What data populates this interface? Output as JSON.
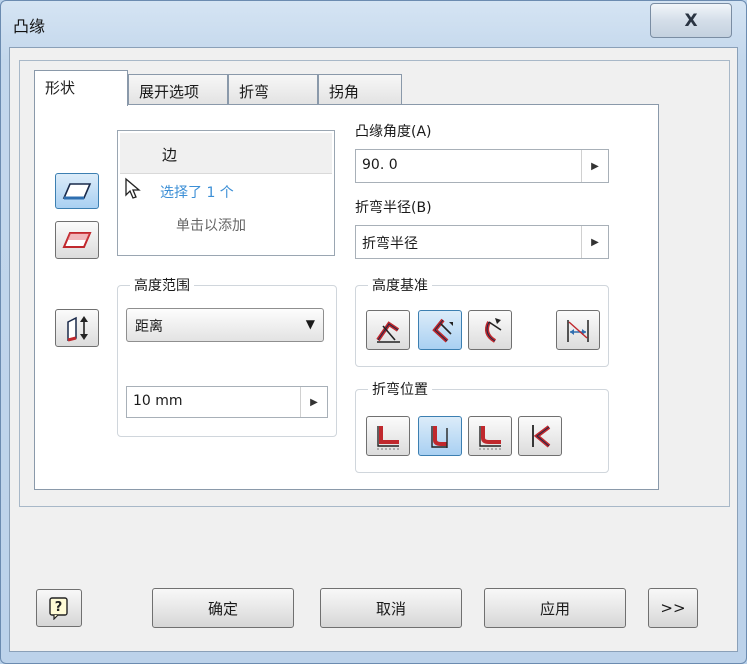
{
  "window": {
    "title": "凸缘",
    "close_label": "X"
  },
  "tabs": [
    {
      "label": "形状",
      "active": true
    },
    {
      "label": "展开选项",
      "active": false
    },
    {
      "label": "折弯",
      "active": false
    },
    {
      "label": "拐角",
      "active": false
    }
  ],
  "edges": {
    "header": "边",
    "selected_text": "选择了 1 个",
    "add_hint": "单击以添加"
  },
  "flange_angle": {
    "label": "凸缘角度(A)",
    "value": "90. 0"
  },
  "bend_radius": {
    "label": "折弯半径(B)",
    "value": "折弯半径"
  },
  "height_extents": {
    "title": "高度范围",
    "mode": "距离",
    "value": "10 mm"
  },
  "height_datum": {
    "title": "高度基准"
  },
  "bend_position": {
    "title": "折弯位置"
  },
  "buttons": {
    "help": "?",
    "ok": "确定",
    "cancel": "取消",
    "apply": "应用",
    "more": ">>"
  },
  "colors": {
    "accent_red": "#c0282d",
    "accent_blue": "#2f6fb0",
    "selection_text": "#3c8fd6"
  }
}
